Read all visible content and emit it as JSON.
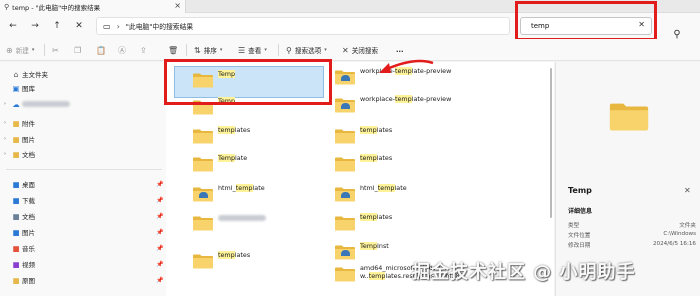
{
  "tab": {
    "title": "temp - \"此电脑\"中的搜索结果"
  },
  "address": {
    "crumb": "\"此电脑\"中的搜索结果"
  },
  "search": {
    "value": "temp"
  },
  "toolbar": {
    "new_label": "新建",
    "sort_label": "排序",
    "view_label": "查看",
    "search_options_label": "搜索选项",
    "close_search_label": "关闭搜索",
    "more_label": "..."
  },
  "sidebar": {
    "home": "主文件夹",
    "gallery": "图库",
    "tree": [
      {
        "label": "附件"
      },
      {
        "label": "图片"
      },
      {
        "label": "文档"
      }
    ],
    "quick": [
      {
        "label": "桌面",
        "icon": "desktop-icon",
        "color": "#2b79d6"
      },
      {
        "label": "下载",
        "icon": "download-icon",
        "color": "#2b79d6"
      },
      {
        "label": "文档",
        "icon": "document-icon",
        "color": "#6b7f99"
      },
      {
        "label": "图片",
        "icon": "picture-icon",
        "color": "#2b79d6"
      },
      {
        "label": "音乐",
        "icon": "music-icon",
        "color": "#e3523a"
      },
      {
        "label": "视频",
        "icon": "video-icon",
        "color": "#8a3fd1"
      },
      {
        "label": "原图",
        "icon": "folder-icon",
        "color": "#e6b84a"
      }
    ]
  },
  "results": {
    "left": [
      {
        "pre": "",
        "match": "Temp",
        "post": ""
      },
      {
        "pre": "",
        "match": "Temp",
        "post": ""
      },
      {
        "pre": "",
        "match": "temp",
        "post": "lates"
      },
      {
        "pre": "",
        "match": "Temp",
        "post": "late"
      },
      {
        "pre": "html_",
        "match": "temp",
        "post": "late"
      },
      {
        "pre": "",
        "match": "",
        "post": ""
      },
      {
        "pre": "",
        "match": "temp",
        "post": "lates"
      }
    ],
    "right": [
      {
        "pre": "workplace-",
        "match": "temp",
        "post": "late-preview"
      },
      {
        "pre": "workplace-",
        "match": "temp",
        "post": "late-preview"
      },
      {
        "pre": "",
        "match": "temp",
        "post": "lates"
      },
      {
        "pre": "",
        "match": "temp",
        "post": "lates"
      },
      {
        "pre": "html_",
        "match": "temp",
        "post": "late"
      },
      {
        "pre": "",
        "match": "temp",
        "post": "lates"
      },
      {
        "pre": "",
        "match": "Temp",
        "post": "Inst"
      },
      {
        "pre": "amd64_microsoft-windows-",
        "match": "",
        "post": "",
        "pre2": "w..",
        "match2": "temp",
        "post2": "lates.resources_31bf385"
      }
    ]
  },
  "details": {
    "title": "Temp",
    "subtitle": "详细信息",
    "rows": [
      {
        "k": "类型",
        "v": "文件夹"
      },
      {
        "k": "文件位置",
        "v": "C:\\Windows"
      },
      {
        "k": "修改日期",
        "v": "2024/6/5 16:16"
      }
    ]
  },
  "watermark": "掘金技术社区 @ 小明助手",
  "colors": {
    "highlight": "#e21b1b",
    "selection": "#cce4f7",
    "folder": "#f2c94c"
  }
}
